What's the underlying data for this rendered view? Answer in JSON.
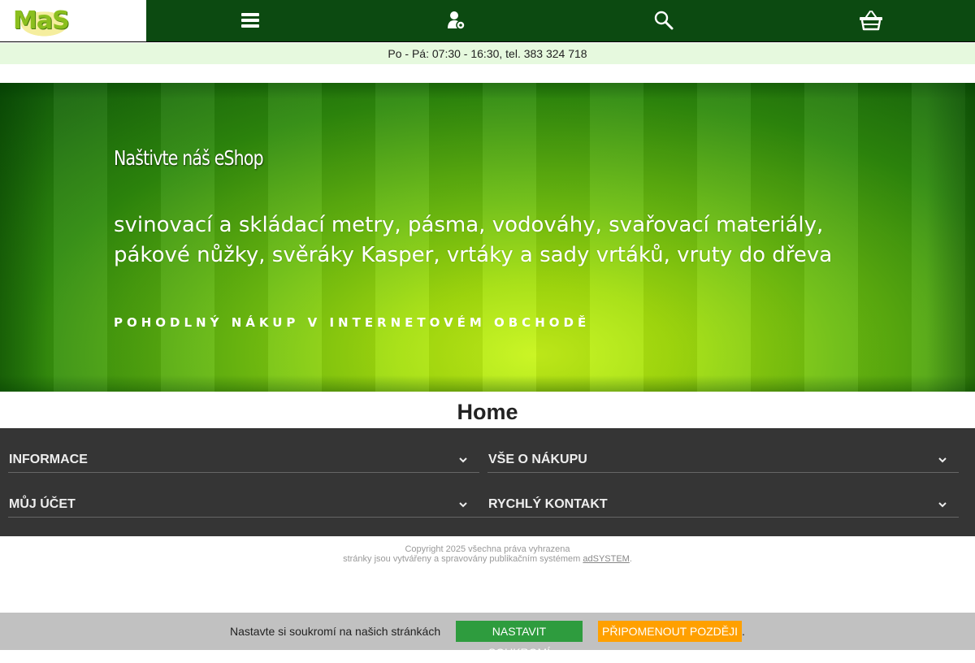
{
  "header": {
    "logo_text": "MaS",
    "icons": [
      "menu-icon",
      "account-settings-icon",
      "search-icon",
      "basket-icon"
    ],
    "nav_color": "#0c4a11"
  },
  "hours": {
    "text": "Po - Pá: 07:30 - 16:30, tel. 383 324 718"
  },
  "banner": {
    "title": "Naštivte náš eShop",
    "text": "svinovací a skládací metry, pásma, vodováhy, svařovací materiály, pákové nůžky, svěráky Kasper, vrtáky a sady vrtáků, vruty do dřeva",
    "tagline": "POHODLNÝ NÁKUP V INTERNETOVÉM OBCHODĚ"
  },
  "page": {
    "title": "Home"
  },
  "footer": {
    "sections": [
      {
        "label": "INFORMACE"
      },
      {
        "label": "VŠE O NÁKUPU"
      },
      {
        "label": "MŮJ ÚČET"
      },
      {
        "label": "RYCHLÝ KONTAKT"
      }
    ],
    "copyright": "Copyright 2025 všechna práva vyhrazena",
    "powered_prefix": "stránky jsou vytvářeny a spravovány publikačním systémem",
    "powered_link": "adSYSTEM",
    "powered_suffix": "."
  },
  "cookie": {
    "text": "Nastavte si soukromí na našich stránkách",
    "set_button": "NASTAVIT SOUKROMÍ",
    "later_button": "PŘIPOMENOUT POZDĚJI",
    "trailing": ".",
    "set_color": "#2e9c3e",
    "later_color": "#ffa000"
  }
}
